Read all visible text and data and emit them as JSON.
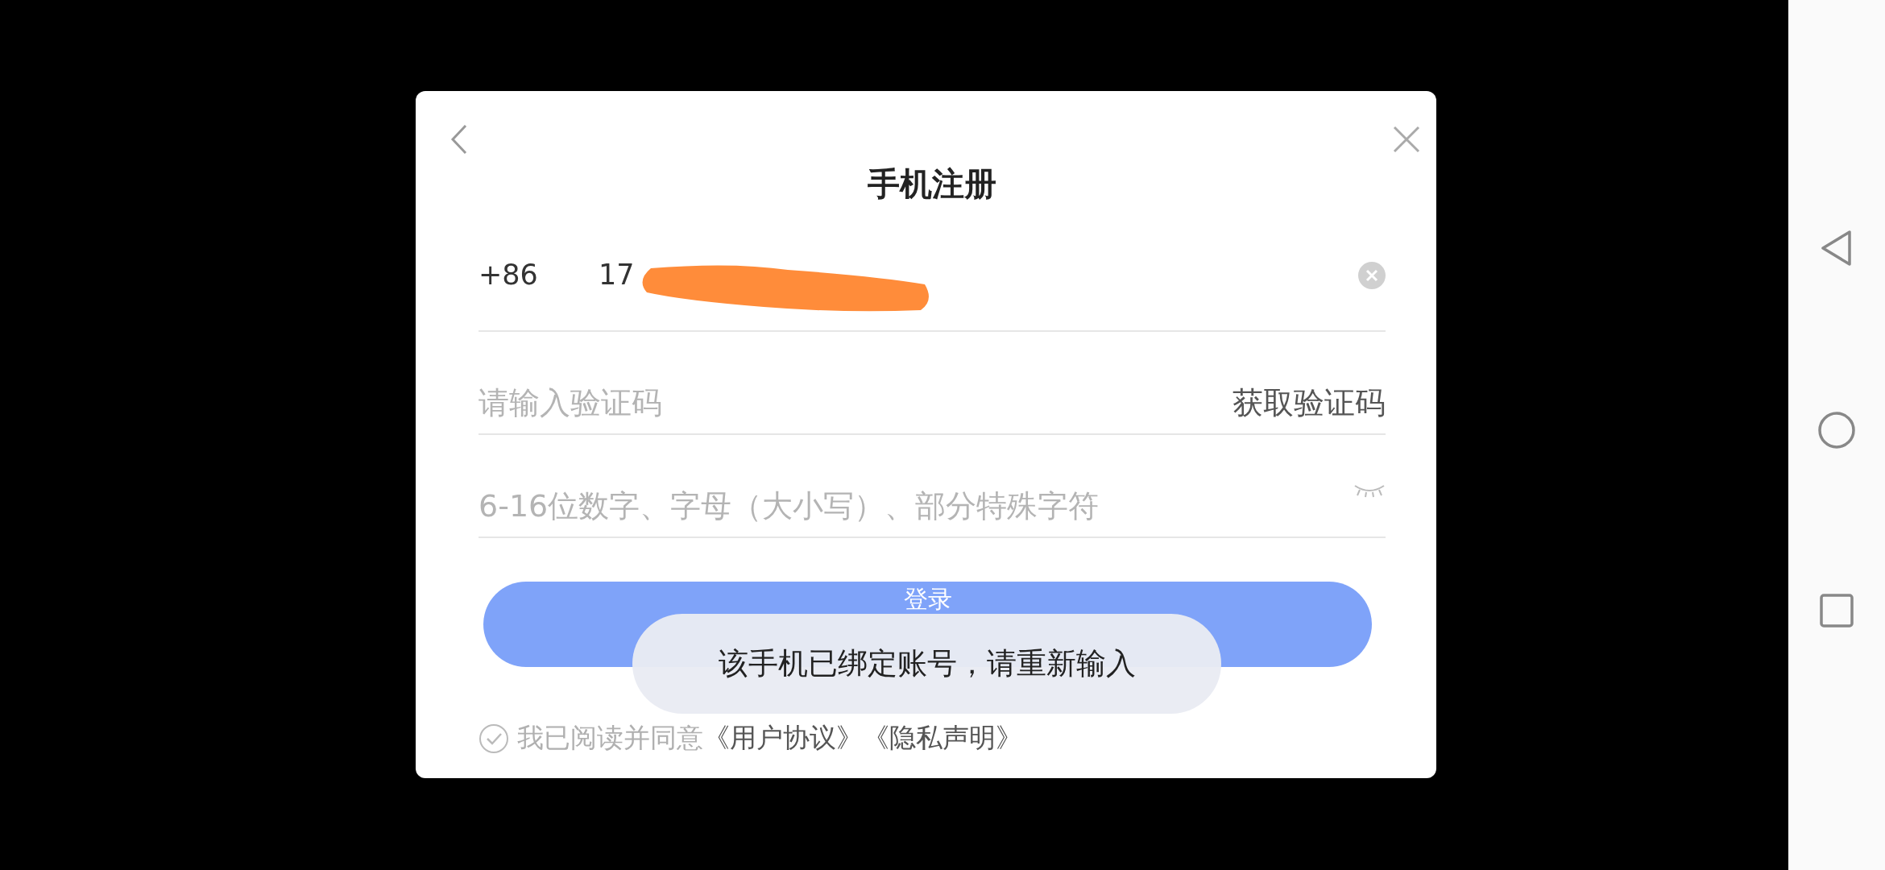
{
  "dialog": {
    "title": "手机注册",
    "phone": {
      "country_code": "+86",
      "value": "17"
    },
    "code_field": {
      "placeholder": "请输入验证码"
    },
    "get_code_button": "获取验证码",
    "password_field": {
      "placeholder": "6-16位数字、字母（大小写）、部分特殊字符"
    },
    "login_button": "登录",
    "agreement": {
      "checked": false,
      "text": "我已阅读并同意",
      "links": [
        "《用户协议》",
        "《隐私声明》"
      ]
    },
    "toast": "该手机已绑定账号，请重新输入"
  }
}
